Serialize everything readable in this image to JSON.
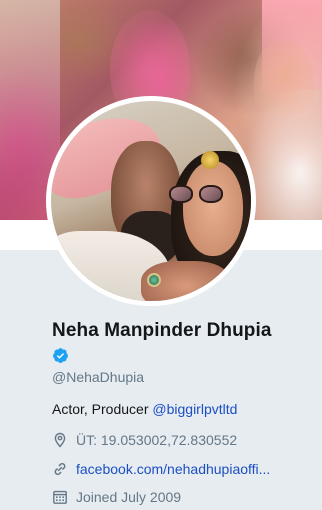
{
  "profile": {
    "name": "Neha Manpinder Dhupia",
    "verified": true,
    "handle": "@NehaDhupia",
    "bio_text": "Actor, Producer ",
    "bio_mention": "@biggirlpvtltd",
    "location": "ÜT: 19.053002,72.830552",
    "website": "facebook.com/nehadhupiaoffi...",
    "joined": "Joined July 2009"
  },
  "icons": {
    "verified": "verified-badge-icon",
    "location": "location-pin-icon",
    "website": "link-icon",
    "joined": "calendar-icon"
  },
  "colors": {
    "verified_blue": "#1da1f2",
    "link_blue": "#1b4fc4",
    "muted_text": "#657786",
    "page_bg": "#e6ecf0"
  }
}
